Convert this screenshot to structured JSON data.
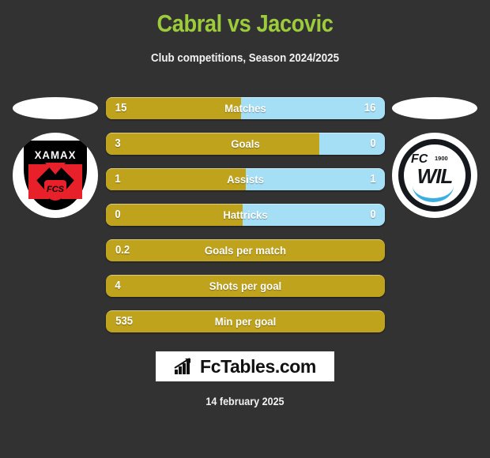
{
  "header": {
    "title": "Cabral vs Jacovic",
    "subtitle": "Club competitions, Season 2024/2025",
    "title_color": "#9ccb3b"
  },
  "theme": {
    "background": "#333233",
    "home_color": "#c0a31c",
    "away_color": "#a5dff5",
    "text_color": "#ffffff"
  },
  "teams": {
    "home": {
      "name": "XAMAX",
      "badge_text": "FCS",
      "logo_icon": "xamax-crest-icon"
    },
    "away": {
      "name": "WIL",
      "prefix": "FC",
      "year": "1900",
      "logo_icon": "fcwil-crest-icon"
    }
  },
  "chart_data": {
    "type": "bar",
    "title": "Cabral vs Jacovic",
    "subtitle": "Club competitions, Season 2024/2025",
    "categories": [
      "Matches",
      "Goals",
      "Assists",
      "Hattricks",
      "Goals per match",
      "Shots per goal",
      "Min per goal"
    ],
    "series": [
      {
        "name": "Cabral",
        "values": [
          "15",
          "3",
          "1",
          "0",
          "0.2",
          "4",
          "535"
        ]
      },
      {
        "name": "Jacovic",
        "values": [
          "16",
          "0",
          "1",
          "0",
          null,
          null,
          null
        ]
      }
    ],
    "legend": "hidden"
  },
  "stats": [
    {
      "label": "Matches",
      "left": "15",
      "right": "16",
      "fill_pct": 48.4,
      "split": true
    },
    {
      "label": "Goals",
      "left": "3",
      "right": "0",
      "fill_pct": 76.4,
      "split": true
    },
    {
      "label": "Assists",
      "left": "1",
      "right": "1",
      "fill_pct": 50.0,
      "split": true
    },
    {
      "label": "Hattricks",
      "left": "0",
      "right": "0",
      "fill_pct": 49.0,
      "split": true
    },
    {
      "label": "Goals per match",
      "left": "0.2",
      "right": "",
      "fill_pct": 100,
      "split": false
    },
    {
      "label": "Shots per goal",
      "left": "4",
      "right": "",
      "fill_pct": 100,
      "split": false
    },
    {
      "label": "Min per goal",
      "left": "535",
      "right": "",
      "fill_pct": 100,
      "split": false
    }
  ],
  "watermark": {
    "text": "FcTables.com",
    "icon": "bar-chart-growth-icon"
  },
  "footer": {
    "date": "14 february 2025"
  }
}
